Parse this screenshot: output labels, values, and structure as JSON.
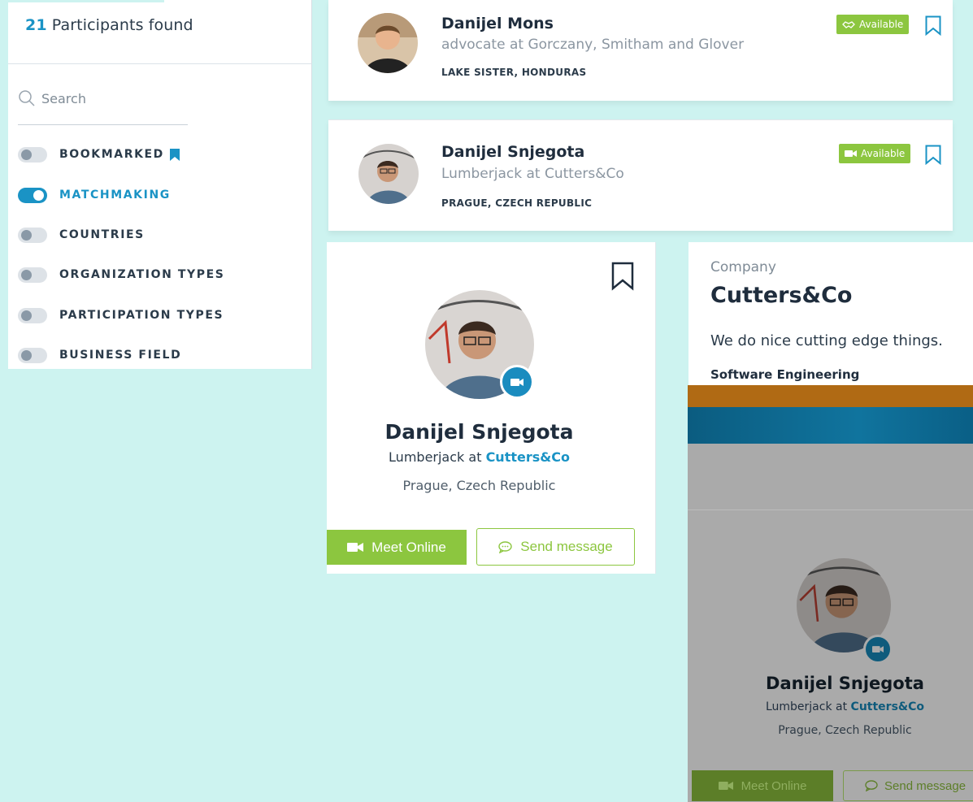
{
  "filters": {
    "count": "21",
    "count_suffix": "Participants found",
    "search_placeholder": "Search",
    "toggles": [
      {
        "label": "BOOKMARKED",
        "on": false
      },
      {
        "label": "MATCHMAKING",
        "on": true
      },
      {
        "label": "COUNTRIES",
        "on": false
      },
      {
        "label": "ORGANIZATION TYPES",
        "on": false
      },
      {
        "label": "PARTICIPATION TYPES",
        "on": false
      },
      {
        "label": "BUSINESS FIELD",
        "on": false
      }
    ]
  },
  "participants": [
    {
      "name": "Danijel Mons",
      "role": "advocate at Gorczany, Smitham and Glover",
      "location": "LAKE SISTER, HONDURAS",
      "badge": "Available",
      "badge_icon": "handshake-icon"
    },
    {
      "name": "Danijel Snjegota",
      "role": "Lumberjack at Cutters&Co",
      "location": "PRAGUE, CZECH REPUBLIC",
      "badge": "Available",
      "badge_icon": "video-camera-icon"
    }
  ],
  "profile": {
    "name": "Danijel Snjegota",
    "role_prefix": "Lumberjack at",
    "company": "Cutters&Co",
    "location": "Prague, Czech Republic",
    "meet_label": "Meet Online",
    "message_label": "Send message"
  },
  "company": {
    "label": "Company",
    "name": "Cutters&Co",
    "description": "We do nice cutting edge things.",
    "field": "Software Engineering"
  },
  "preview": {
    "name": "Danijel Snjegota",
    "role_prefix": "Lumberjack at",
    "company": "Cutters&Co",
    "location": "Prague, Czech Republic",
    "meet_label": "Meet Online",
    "message_label": "Send message"
  },
  "colors": {
    "accent_blue": "#1a93c5",
    "accent_green": "#8cc63f",
    "page_background": "#cdf3f0"
  }
}
